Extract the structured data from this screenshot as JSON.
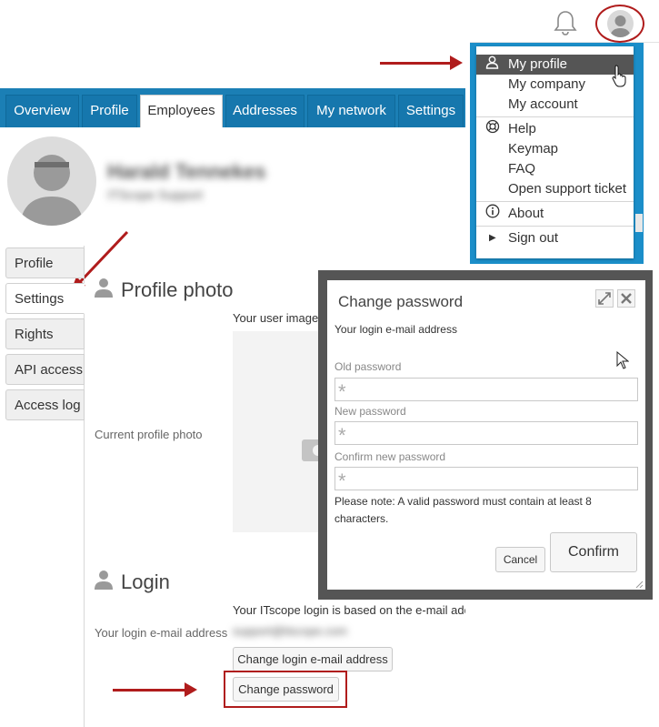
{
  "tabs": [
    "Overview",
    "Profile",
    "Employees",
    "Addresses",
    "My network",
    "Settings"
  ],
  "active_tab": "Employees",
  "profile": {
    "name": "Harald Tennekes",
    "subtitle": "ITScope Support"
  },
  "side_nav": [
    "Profile",
    "Settings",
    "Rights",
    "API access",
    "Access log"
  ],
  "profile_photo": {
    "title": "Profile photo",
    "user_image_label": "Your user image",
    "current_label": "Current profile photo",
    "overlay_fragment": "o"
  },
  "login": {
    "title": "Login",
    "info": "Your ITscope login is based on the e-mail addr",
    "email_label": "Your login e-mail address",
    "email_value": "support@itscope.com",
    "change_email_button": "Change login e-mail address",
    "change_password_button": "Change password"
  },
  "user_menu": {
    "items": [
      {
        "label": "My profile",
        "icon": "user-icon"
      },
      {
        "label": "My company"
      },
      {
        "label": "My account"
      },
      {
        "label": "Help",
        "icon": "lifebuoy-icon"
      },
      {
        "label": "Keymap"
      },
      {
        "label": "FAQ"
      },
      {
        "label": "Open support ticket"
      },
      {
        "label": "About",
        "icon": "info-icon"
      },
      {
        "label": "Sign out",
        "icon": "triangle-right-icon"
      }
    ],
    "highlighted": "My profile"
  },
  "dialog": {
    "title": "Change password",
    "email_label": "Your login e-mail address",
    "old_password_label": "Old password",
    "new_password_label": "New password",
    "confirm_password_label": "Confirm new password",
    "note": "Please note: A valid password must contain at least 8 characters.",
    "cancel_label": "Cancel",
    "confirm_label": "Confirm",
    "required_marker": "*"
  },
  "colors": {
    "accent": "#1b7fb5",
    "highlight_red": "#b01c1c",
    "menu_highlight": "#555555"
  }
}
